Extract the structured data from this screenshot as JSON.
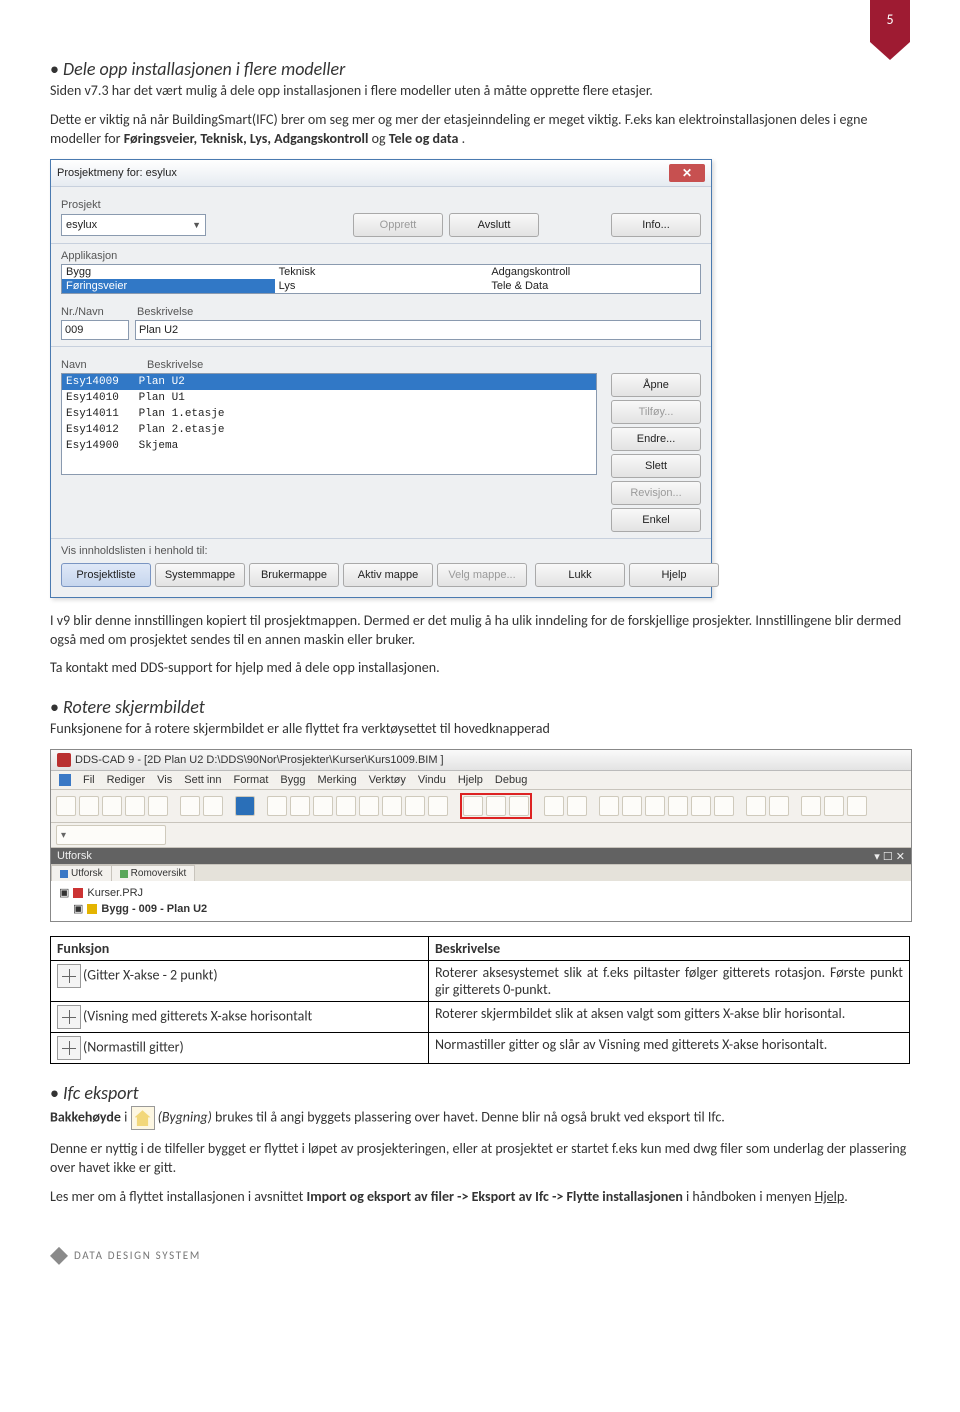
{
  "page": {
    "number": "5"
  },
  "s1": {
    "title": "Dele opp installasjonen i flere modeller",
    "p1": "Siden v7.3 har det vært mulig å dele opp installasjonen i flere modeller uten å måtte opprette flere etasjer.",
    "p2a": "Dette er viktig nå når BuildingSmart(IFC) brer om seg mer og mer der etasjeinndeling er meget viktig. F.eks kan elektroinstallasjonen deles i egne modeller for ",
    "p2b": "Føringsveier, Teknisk, Lys, Adgangskontroll",
    "p2c": " og ",
    "p2d": "Tele og data",
    "p2e": "."
  },
  "dlg": {
    "title": "Prosjektmeny for: esylux",
    "lbl_prosjekt": "Prosjekt",
    "combo_value": "esylux",
    "btn_opprett": "Opprett",
    "btn_avslutt": "Avslutt",
    "btn_info": "Info...",
    "lbl_app": "Applikasjon",
    "app_col1": [
      "Bygg",
      "Føringsveier"
    ],
    "app_col2": [
      "Teknisk",
      "Lys"
    ],
    "app_col3": [
      "Adgangskontroll",
      "Tele & Data"
    ],
    "lbl_nr": "Nr./Navn",
    "lbl_besk": "Beskrivelse",
    "nr_val": "009",
    "besk_val": "Plan U2",
    "lbl_navn": "Navn",
    "files": [
      {
        "n": "Esy14009",
        "d": "Plan U2",
        "hl": true
      },
      {
        "n": "Esy14010",
        "d": "Plan U1"
      },
      {
        "n": "Esy14011",
        "d": "Plan 1.etasje"
      },
      {
        "n": "Esy14012",
        "d": "Plan 2.etasje"
      },
      {
        "n": "Esy14900",
        "d": "Skjema"
      }
    ],
    "btn_apne": "Åpne",
    "btn_tilfoy": "Tilføy...",
    "btn_endre": "Endre...",
    "btn_slett": "Slett",
    "btn_rev": "Revisjon...",
    "btn_enkel": "Enkel",
    "lbl_vis": "Vis innholdslisten i henhold til:",
    "btn_prj": "Prosjektliste",
    "btn_sys": "Systemmappe",
    "btn_bruk": "Brukermappe",
    "btn_akt": "Aktiv mappe",
    "btn_velg": "Velg mappe...",
    "btn_lukk": "Lukk",
    "btn_hjelp": "Hjelp"
  },
  "mid": {
    "p1": "I v9 blir denne innstillingen kopiert til prosjektmappen. Dermed er det mulig å ha ulik inndeling for de forskjellige prosjekter. Innstillingene blir dermed også med om prosjektet sendes til en annen maskin eller bruker.",
    "p2": "Ta kontakt med DDS-support for hjelp med å dele opp installasjonen."
  },
  "s2": {
    "title": "Rotere skjermbildet",
    "p": "Funksjonene for å rotere skjermbildet er alle flyttet fra verktøysettet til hovedknapperad"
  },
  "app": {
    "title": "DDS-CAD 9 - [2D  Plan U2  D:\\DDS\\90Nor\\Prosjekter\\Kurser\\Kurs1009.BIM ]",
    "menus": [
      "Fil",
      "Rediger",
      "Vis",
      "Sett inn",
      "Format",
      "Bygg",
      "Merking",
      "Verktøy",
      "Vindu",
      "Hjelp",
      "Debug"
    ],
    "side": "Utforsk",
    "tab1": "Utforsk",
    "tab2": "Romoversikt",
    "tree1": "Kurser.PRJ",
    "tree2": "Bygg - 009 - Plan U2"
  },
  "tbl": {
    "h1": "Funksjon",
    "h2": "Beskrivelse",
    "r1f": "(Gitter X-akse - 2 punkt)",
    "r1d": "Roterer aksesystemet slik at f.eks piltaster følger gitterets rotasjon. Første punkt gir gitterets 0-punkt.",
    "r2f": "(Visning med gitterets X-akse horisontalt",
    "r2d": "Roterer skjermbildet slik at aksen valgt som gitters X-akse blir horisontal.",
    "r3f": "(Normastill gitter)",
    "r3d": "Normastiller gitter og slår av Visning med gitterets X-akse horisontalt."
  },
  "s3": {
    "title": "Ifc eksport",
    "p1a": "Bakkehøyde",
    "p1b": " i ",
    "p1c": " (Bygning)",
    "p1d": " brukes til å angi byggets plassering over havet. Denne blir nå også brukt ved eksport til Ifc.",
    "p2": "Denne er nyttig i de tilfeller bygget er flyttet i løpet av prosjekteringen, eller at prosjektet er startet f.eks kun med dwg filer som underlag der plassering over havet ikke er gitt.",
    "p3a": "Les mer om å flyttet installasjonen i avsnittet ",
    "p3b": "Import og eksport av filer -> Eksport av Ifc -> Flytte installasjonen",
    "p3c": " i håndboken i menyen ",
    "p3d": "Hjelp",
    "p3e": "."
  },
  "footer": "DATA DESIGN SYSTEM"
}
